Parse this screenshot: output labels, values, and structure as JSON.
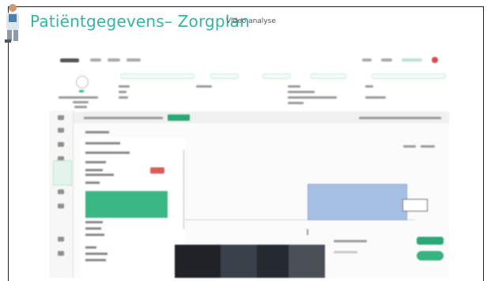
{
  "slide": {
    "title": "Patiëntgegevens– Zorgplan",
    "subtitle": "Video analyse"
  },
  "embedded_screenshot": {
    "description_visible": false,
    "accent_color": "#36b3a3",
    "highlight_green": "#2aa876",
    "badge_red": "#d95b5b",
    "bar_blue": "#a6c0e4"
  }
}
